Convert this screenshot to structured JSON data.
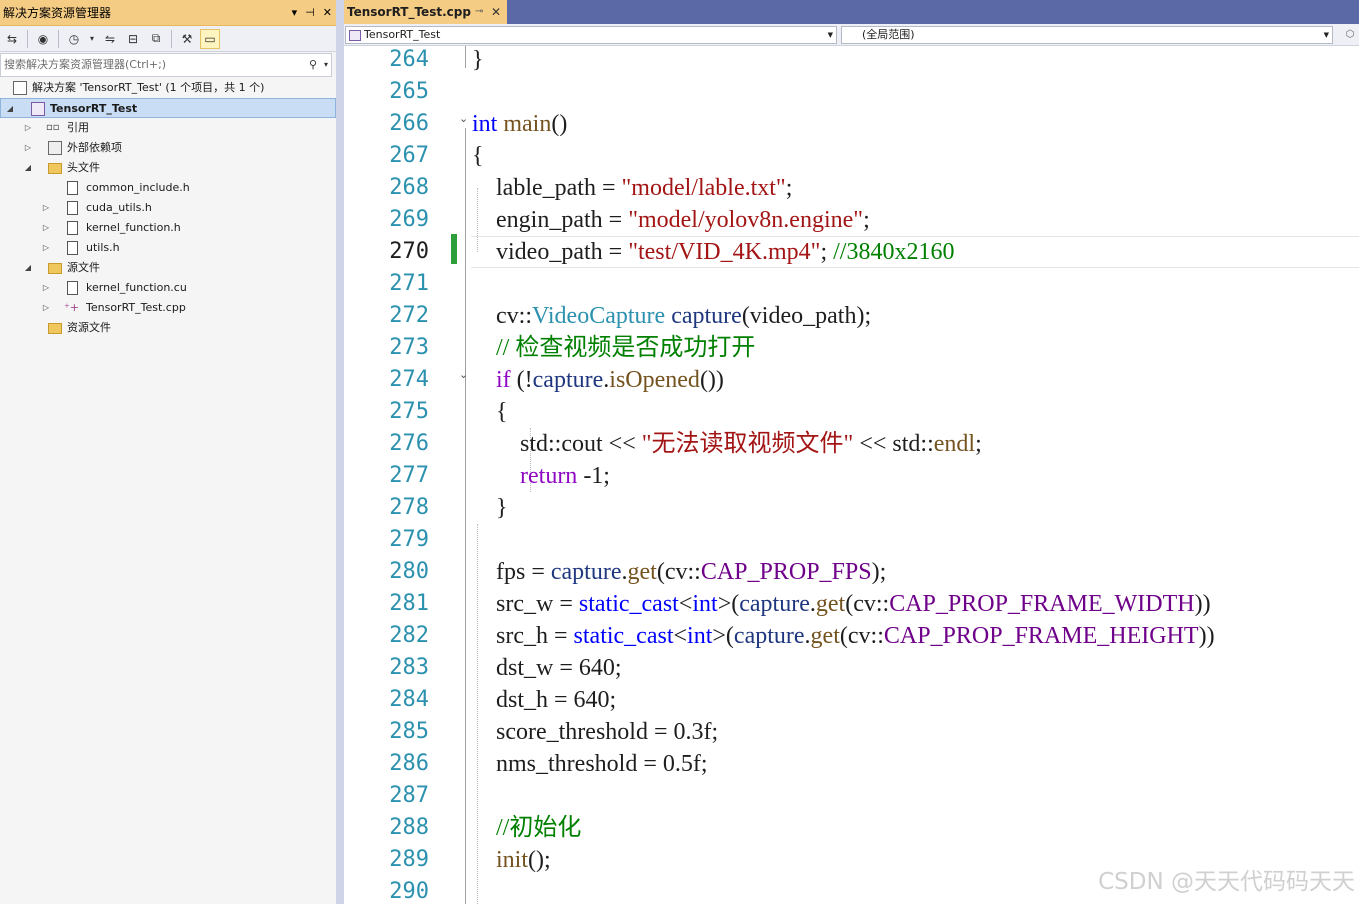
{
  "solution_explorer": {
    "title": "解决方案资源管理器",
    "title_buttons": [
      "▾",
      "⊣",
      "✕"
    ],
    "search_placeholder": "搜索解决方案资源管理器(Ctrl+;)",
    "items": [
      {
        "label": "解决方案 'TensorRT_Test' (1 个项目，共 1 个)",
        "icon": "solution-icon"
      },
      {
        "label": "TensorRT_Test",
        "icon": "project-icon",
        "selected": true
      },
      {
        "label": "引用",
        "icon": "references-icon"
      },
      {
        "label": "外部依赖项",
        "icon": "external-deps-icon"
      },
      {
        "label": "头文件",
        "icon": "folder-icon"
      },
      {
        "label": "common_include.h",
        "icon": "header-file-icon"
      },
      {
        "label": "cuda_utils.h",
        "icon": "header-file-icon"
      },
      {
        "label": "kernel_function.h",
        "icon": "header-file-icon"
      },
      {
        "label": "utils.h",
        "icon": "header-file-icon"
      },
      {
        "label": "源文件",
        "icon": "folder-icon"
      },
      {
        "label": "kernel_function.cu",
        "icon": "source-file-icon"
      },
      {
        "label": "TensorRT_Test.cpp",
        "icon": "cpp-file-icon"
      },
      {
        "label": "资源文件",
        "icon": "folder-icon"
      }
    ]
  },
  "editor": {
    "tab": {
      "label": "TensorRT_Test.cpp",
      "pin": "⊸",
      "close": "✕"
    },
    "nav": {
      "project_combo": "TensorRT_Test",
      "scope_combo": "(全局范围)"
    },
    "current_line": 270,
    "lines": [
      {
        "n": "264",
        "t": [
          [
            "",
            "}"
          ]
        ]
      },
      {
        "n": "265",
        "t": []
      },
      {
        "n": "266",
        "t": [
          [
            "kw",
            "int"
          ],
          [
            "",
            " "
          ],
          [
            "fn",
            "main"
          ],
          [
            "",
            "()"
          ]
        ]
      },
      {
        "n": "267",
        "t": [
          [
            "",
            "{"
          ]
        ]
      },
      {
        "n": "268",
        "t": [
          [
            "",
            "    lable_path = "
          ],
          [
            "str",
            "\"model/lable.txt\""
          ],
          [
            "",
            ";"
          ]
        ]
      },
      {
        "n": "269",
        "t": [
          [
            "",
            "    engin_path = "
          ],
          [
            "str",
            "\"model/yolov8n.engine\""
          ],
          [
            "",
            ";"
          ]
        ]
      },
      {
        "n": "270",
        "t": [
          [
            "",
            "    video_path = "
          ],
          [
            "str",
            "\"test/VID_4K.mp4\""
          ],
          [
            "",
            "; "
          ],
          [
            "cmt",
            "//3840x2160"
          ]
        ]
      },
      {
        "n": "271",
        "t": []
      },
      {
        "n": "272",
        "t": [
          [
            "",
            "    cv::"
          ],
          [
            "typ",
            "VideoCapture"
          ],
          [
            "",
            " "
          ],
          [
            "var",
            "capture"
          ],
          [
            "",
            "(video_path);"
          ]
        ]
      },
      {
        "n": "273",
        "t": [
          [
            "cmt",
            "    // 检查视频是否成功打开"
          ]
        ]
      },
      {
        "n": "274",
        "t": [
          [
            "kw2",
            "    if"
          ],
          [
            "",
            " (!"
          ],
          [
            "var",
            "capture"
          ],
          [
            "",
            "."
          ],
          [
            "fn",
            "isOpened"
          ],
          [
            "",
            "())"
          ]
        ]
      },
      {
        "n": "275",
        "t": [
          [
            "",
            "    {"
          ]
        ]
      },
      {
        "n": "276",
        "t": [
          [
            "",
            "        std::cout << "
          ],
          [
            "str",
            "\"无法读取视频文件\""
          ],
          [
            "",
            " << std::"
          ],
          [
            "fn",
            "endl"
          ],
          [
            "",
            ";"
          ]
        ]
      },
      {
        "n": "277",
        "t": [
          [
            "kw2",
            "        return"
          ],
          [
            "",
            " -1;"
          ]
        ]
      },
      {
        "n": "278",
        "t": [
          [
            "",
            "    }"
          ]
        ]
      },
      {
        "n": "279",
        "t": []
      },
      {
        "n": "280",
        "t": [
          [
            "",
            "    fps = "
          ],
          [
            "var",
            "capture"
          ],
          [
            "",
            "."
          ],
          [
            "fn",
            "get"
          ],
          [
            "",
            "(cv::"
          ],
          [
            "mac",
            "CAP_PROP_FPS"
          ],
          [
            "",
            ");"
          ]
        ]
      },
      {
        "n": "281",
        "t": [
          [
            "",
            "    src_w = "
          ],
          [
            "kw",
            "static_cast"
          ],
          [
            "",
            "<"
          ],
          [
            "kw",
            "int"
          ],
          [
            "",
            ">("
          ],
          [
            "var",
            "capture"
          ],
          [
            "",
            "."
          ],
          [
            "fn",
            "get"
          ],
          [
            "",
            "(cv::"
          ],
          [
            "mac",
            "CAP_PROP_FRAME_WIDTH"
          ],
          [
            "",
            "))"
          ]
        ]
      },
      {
        "n": "282",
        "t": [
          [
            "",
            "    src_h = "
          ],
          [
            "kw",
            "static_cast"
          ],
          [
            "",
            "<"
          ],
          [
            "kw",
            "int"
          ],
          [
            "",
            ">("
          ],
          [
            "var",
            "capture"
          ],
          [
            "",
            "."
          ],
          [
            "fn",
            "get"
          ],
          [
            "",
            "(cv::"
          ],
          [
            "mac",
            "CAP_PROP_FRAME_HEIGHT"
          ],
          [
            "",
            "))"
          ]
        ]
      },
      {
        "n": "283",
        "t": [
          [
            "",
            "    dst_w = 640;"
          ]
        ]
      },
      {
        "n": "284",
        "t": [
          [
            "",
            "    dst_h = 640;"
          ]
        ]
      },
      {
        "n": "285",
        "t": [
          [
            "",
            "    score_threshold = 0.3f;"
          ]
        ]
      },
      {
        "n": "286",
        "t": [
          [
            "",
            "    nms_threshold = 0.5f;"
          ]
        ]
      },
      {
        "n": "287",
        "t": []
      },
      {
        "n": "288",
        "t": [
          [
            "cmt",
            "    //初始化"
          ]
        ]
      },
      {
        "n": "289",
        "t": [
          [
            "fn",
            "    init"
          ],
          [
            "",
            "();"
          ]
        ]
      },
      {
        "n": "290",
        "t": []
      }
    ]
  },
  "watermark": "CSDN @天天代码码天天"
}
